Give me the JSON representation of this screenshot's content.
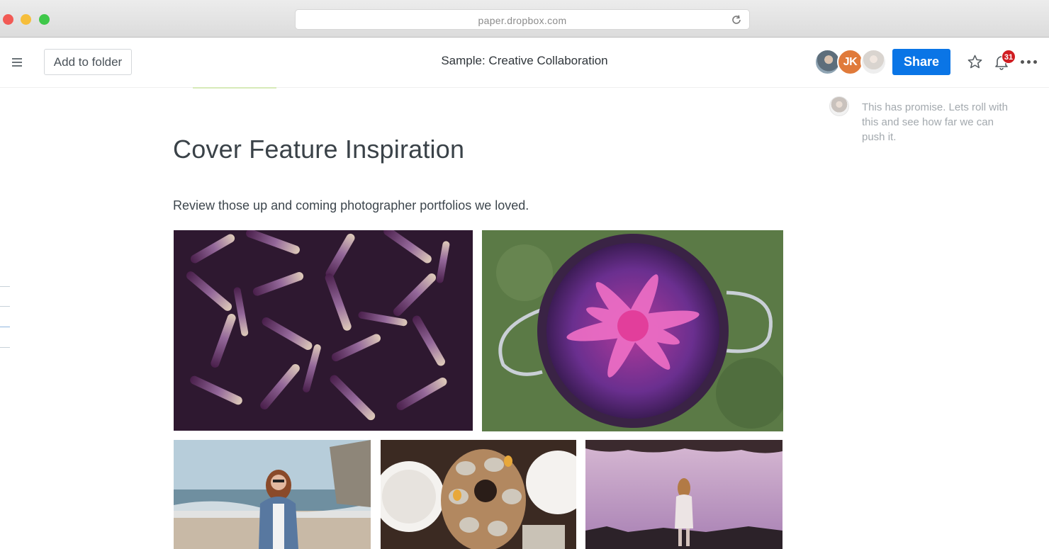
{
  "browser": {
    "url": "paper.dropbox.com",
    "buttons": [
      "close-window",
      "minimize-window",
      "zoom-window"
    ]
  },
  "header": {
    "add_to_folder_label": "Add to folder",
    "doc_title": "Sample: Creative Collaboration",
    "share_label": "Share",
    "collaborators": [
      {
        "initials": "",
        "kind": "photo"
      },
      {
        "initials": "JK",
        "kind": "initials",
        "color": "#e07a3a"
      },
      {
        "initials": "",
        "kind": "photo"
      }
    ],
    "notification_count": "31",
    "accent_color": "#0a75e6",
    "badge_color": "#d01d22"
  },
  "comment": {
    "text": "This has promise. Lets roll with this and see how far we can push it."
  },
  "document": {
    "heading": "Cover Feature Inspiration",
    "paragraph": "Review those up and coming photographer portfolios we loved.",
    "photos": [
      {
        "subject": "purple sea urchin spines"
      },
      {
        "subject": "pink starfish in purple bowl on grass"
      },
      {
        "subject": "woman with sunglasses on beach"
      },
      {
        "subject": "oysters on platter"
      },
      {
        "subject": "woman standing in purple landscape"
      }
    ]
  }
}
